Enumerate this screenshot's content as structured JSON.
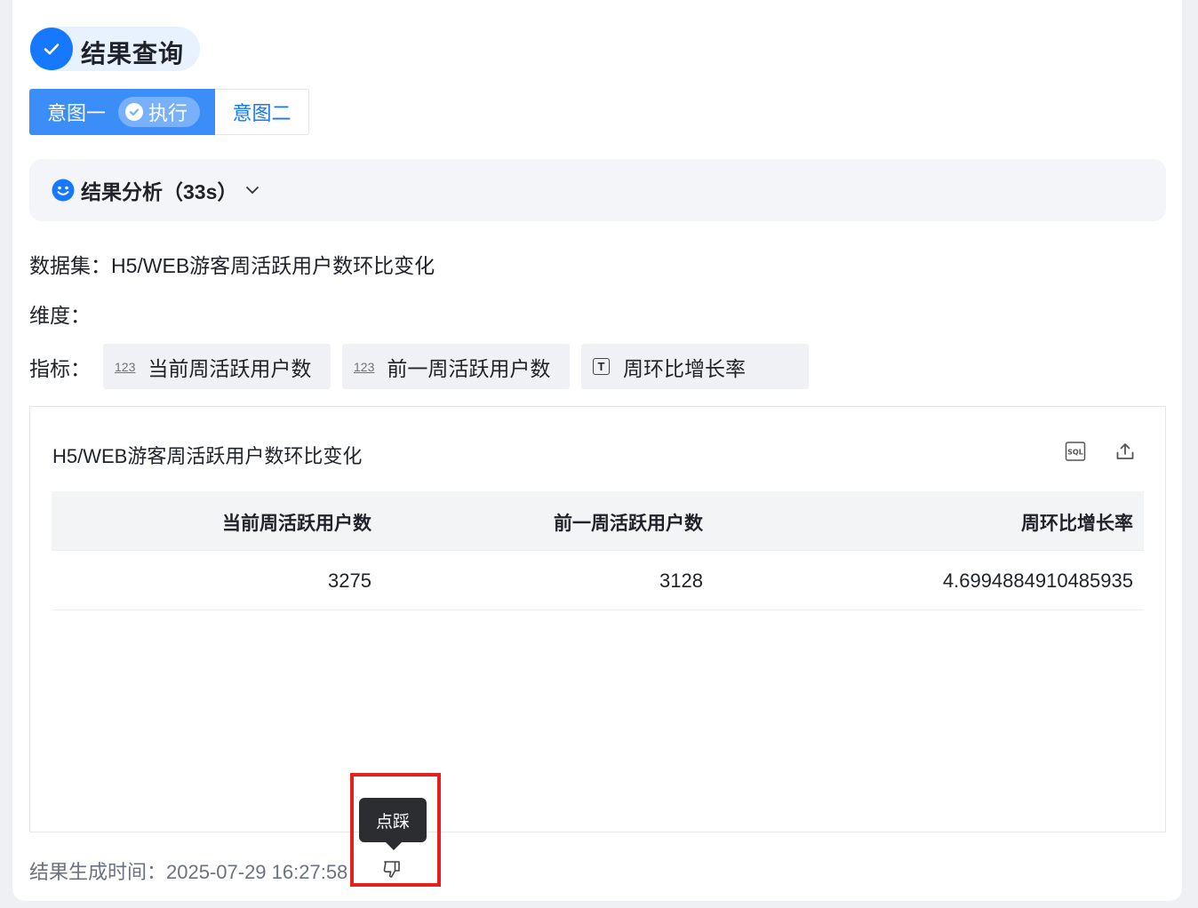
{
  "header": {
    "title": "结果查询"
  },
  "tabs": {
    "intent1_label": "意图一",
    "intent1_status": "执行",
    "intent2_label": "意图二"
  },
  "analysis": {
    "label": "结果分析（33s）"
  },
  "dataset": {
    "prefix": "数据集：",
    "value": "H5/WEB游客周活跃用户数环比变化"
  },
  "dimension": {
    "prefix": "维度："
  },
  "metrics": {
    "prefix": "指标：",
    "items": [
      {
        "icon": "123",
        "label": "当前周活跃用户数"
      },
      {
        "icon": "123",
        "label": "前一周活跃用户数"
      },
      {
        "icon": "T",
        "label": "周环比增长率"
      }
    ]
  },
  "result": {
    "title": "H5/WEB游客周活跃用户数环比变化",
    "columns": [
      "当前周活跃用户数",
      "前一周活跃用户数",
      "周环比增长率"
    ],
    "rows": [
      [
        "3275",
        "3128",
        "4.6994884910485935"
      ]
    ]
  },
  "footer": {
    "generated_label": "结果生成时间：2025-07-29 16:27:58"
  },
  "tooltip": {
    "text": "点踩"
  },
  "colors": {
    "accent": "#1677ff",
    "tab_active": "#3b8ef8",
    "highlight": "#e8201b"
  }
}
